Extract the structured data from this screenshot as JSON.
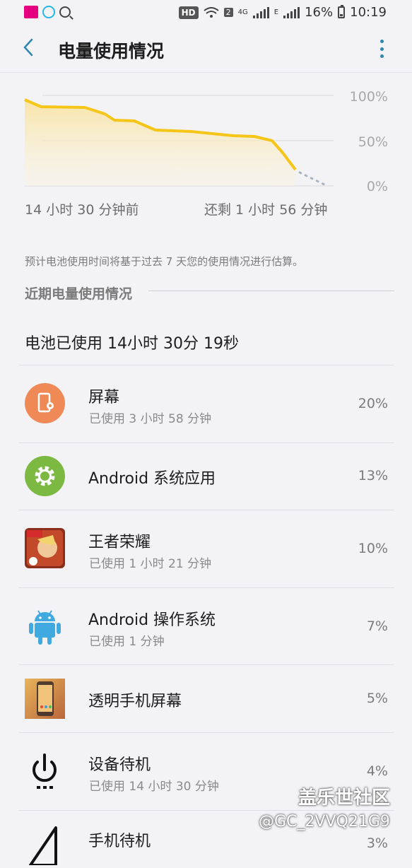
{
  "status_bar": {
    "hd": "HD",
    "sim_badge": "2",
    "network_4g": "4G",
    "network_e": "E",
    "battery_percent": "16%",
    "time": "10:19"
  },
  "header": {
    "title": "电量使用情况"
  },
  "chart": {
    "axis_labels": [
      "100%",
      "50%",
      "0%"
    ],
    "time_start": "14 小时 30 分钟前",
    "time_remaining": "还剩 1 小时 56 分钟",
    "line_color": "#f5c518"
  },
  "estimate_note": "预计电池使用时间将基于过去 7 天您的使用情况进行估算。",
  "section_title": "近期电量使用情况",
  "total_usage": "电池已使用 14小时 30分 19秒",
  "apps": [
    {
      "name": "屏幕",
      "sub": "已使用 3 小时 58 分钟",
      "percent": "20%",
      "icon": "screen-icon"
    },
    {
      "name": "Android 系统应用",
      "sub": "",
      "percent": "13%",
      "icon": "gear-icon"
    },
    {
      "name": "王者荣耀",
      "sub": "已使用 1 小时 21 分钟",
      "percent": "10%",
      "icon": "game-icon"
    },
    {
      "name": "Android 操作系统",
      "sub": "已使用 1 分钟",
      "percent": "7%",
      "icon": "android-icon"
    },
    {
      "name": "透明手机屏幕",
      "sub": "",
      "percent": "5%",
      "icon": "phone-wallpaper-icon"
    },
    {
      "name": "设备待机",
      "sub": "已使用 14 小时 30 分钟",
      "percent": "4%",
      "icon": "power-icon"
    },
    {
      "name": "手机待机",
      "sub": "",
      "percent": "3%",
      "icon": "signal-icon"
    }
  ],
  "watermark": {
    "line1": "盖乐世社区",
    "line2": "@GC_2VVQ21G9"
  }
}
